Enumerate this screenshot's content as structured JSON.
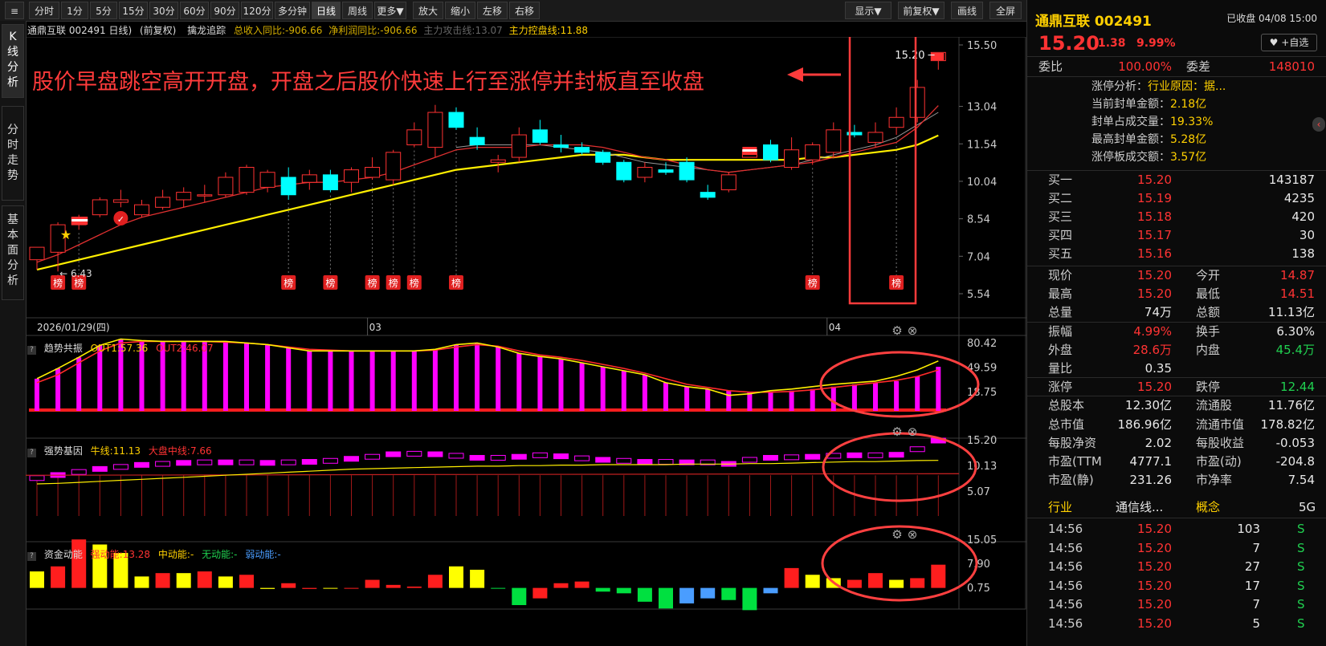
{
  "toolbar": {
    "periods": [
      "分时",
      "1分",
      "5分",
      "15分",
      "30分",
      "60分",
      "90分",
      "120分",
      "多分钟",
      "日线",
      "周线",
      "更多▼",
      "放大",
      "缩小",
      "左移",
      "右移"
    ],
    "active": "日线",
    "right_buttons": [
      "显示▼",
      "前复权▼",
      "画线",
      "全屏"
    ]
  },
  "left_tabs": [
    "K线分析",
    "分时走势",
    "基本面分析"
  ],
  "kline_info": {
    "stock": "通鼎互联 002491 日线)",
    "adjust": "(前复权)",
    "indicator": "擒龙追踪",
    "revenue_yoy": "总收入同比:-906.66",
    "profit_yoy": "净利润同比:-906.66",
    "attack_line": "主力攻击线:13.07",
    "control_line": "主力控盘线:11.88"
  },
  "annotation": {
    "text": "股价早盘跳空高开开盘，开盘之后股价快速上行至涨停并封板直至收盘",
    "color": "#ff3b3b"
  },
  "price_axis": [
    "15.50",
    "13.04",
    "11.54",
    "10.04",
    "8.54",
    "7.04",
    "5.54"
  ],
  "date_axis": [
    "2026/01/29(四)",
    "03",
    "04"
  ],
  "labels": {
    "low_price": "6.43",
    "high_price": "15.20",
    "bang": "榜"
  },
  "trend_panel": {
    "title": "趋势共振",
    "out1": "OUT1:57.36",
    "out2": "OUT2:46.07",
    "axis": [
      "80.42",
      "49.59",
      "18.75"
    ]
  },
  "gene_panel": {
    "title": "强势基因",
    "bull": "牛线:11.13",
    "market": "大盘中线:7.66",
    "axis": [
      "15.20",
      "10.13",
      "5.07"
    ]
  },
  "fund_panel": {
    "title": "资金动能",
    "strong": "强动能:13.28",
    "mid": "中动能:-",
    "none": "无动能:-",
    "weak": "弱动能:-",
    "axis": [
      "15.05",
      "7.90",
      "0.75"
    ]
  },
  "quote": {
    "name": "通鼎互联 002491",
    "status": "已收盘 04/08 15:00",
    "price": "15.20",
    "change": "1.38",
    "pct": "9.99%",
    "self_select": "+自选",
    "wb_label": "委比",
    "wb": "100.00%",
    "wc_label": "委差",
    "wc": "148010",
    "limit_analysis": [
      {
        "label": "涨停分析：",
        "value": "行业原因：据..."
      },
      {
        "label": "当前封单金额：",
        "value": "2.18亿"
      },
      {
        "label": "封单占成交量：",
        "value": "19.33%"
      },
      {
        "label": "最高封单金额：",
        "value": "5.28亿"
      },
      {
        "label": "涨停板成交额：",
        "value": "3.57亿"
      }
    ],
    "bids": [
      {
        "label": "买一",
        "price": "15.20",
        "vol": "143187"
      },
      {
        "label": "买二",
        "price": "15.19",
        "vol": "4235"
      },
      {
        "label": "买三",
        "price": "15.18",
        "vol": "420"
      },
      {
        "label": "买四",
        "price": "15.17",
        "vol": "30"
      },
      {
        "label": "买五",
        "price": "15.16",
        "vol": "138"
      }
    ],
    "stats": [
      {
        "l1": "现价",
        "v1": "15.20",
        "c1": "red",
        "l2": "今开",
        "v2": "14.87",
        "c2": "red"
      },
      {
        "l1": "最高",
        "v1": "15.20",
        "c1": "red",
        "l2": "最低",
        "v2": "14.51",
        "c2": "red"
      },
      {
        "l1": "总量",
        "v1": "74万",
        "c1": "white",
        "l2": "总额",
        "v2": "11.13亿",
        "c2": "white"
      },
      {
        "l1": "振幅",
        "v1": "4.99%",
        "c1": "red",
        "l2": "换手",
        "v2": "6.30%",
        "c2": "white"
      },
      {
        "l1": "外盘",
        "v1": "28.6万",
        "c1": "red",
        "l2": "内盘",
        "v2": "45.4万",
        "c2": "green"
      },
      {
        "l1": "量比",
        "v1": "0.35",
        "c1": "white",
        "l2": "",
        "v2": "",
        "c2": "white"
      },
      {
        "l1": "涨停",
        "v1": "15.20",
        "c1": "red",
        "l2": "跌停",
        "v2": "12.44",
        "c2": "green"
      },
      {
        "l1": "总股本",
        "v1": "12.30亿",
        "c1": "white",
        "l2": "流通股",
        "v2": "11.76亿",
        "c2": "white"
      },
      {
        "l1": "总市值",
        "v1": "186.96亿",
        "c1": "white",
        "l2": "流通市值",
        "v2": "178.82亿",
        "c2": "white"
      },
      {
        "l1": "每股净资",
        "v1": "2.02",
        "c1": "white",
        "l2": "每股收益",
        "v2": "-0.053",
        "c2": "white"
      },
      {
        "l1": "市盈(TTM",
        "v1": "4777.1",
        "c1": "white",
        "l2": "市盈(动)",
        "v2": "-204.8",
        "c2": "white"
      },
      {
        "l1": "市盈(静)",
        "v1": "231.26",
        "c1": "white",
        "l2": "市净率",
        "v2": "7.54",
        "c2": "white"
      }
    ],
    "industry_label": "行业",
    "industry": "通信线...",
    "concept_label": "概念",
    "concept": "5G",
    "trades": [
      {
        "time": "14:56",
        "price": "15.20",
        "vol": "103",
        "side": "S"
      },
      {
        "time": "14:56",
        "price": "15.20",
        "vol": "7",
        "side": "S"
      },
      {
        "time": "14:56",
        "price": "15.20",
        "vol": "27",
        "side": "S"
      },
      {
        "time": "14:56",
        "price": "15.20",
        "vol": "17",
        "side": "S"
      },
      {
        "time": "14:56",
        "price": "15.20",
        "vol": "7",
        "side": "S"
      },
      {
        "time": "14:56",
        "price": "15.20",
        "vol": "5",
        "side": "S"
      }
    ]
  },
  "chart_data": {
    "type": "candlestick",
    "candles": [
      {
        "o": 6.9,
        "h": 7.3,
        "l": 6.5,
        "c": 7.4
      },
      {
        "o": 7.2,
        "h": 8.4,
        "l": 6.43,
        "c": 8.3
      },
      {
        "o": 8.3,
        "h": 8.7,
        "l": 8.1,
        "c": 8.6
      },
      {
        "o": 8.7,
        "h": 9.4,
        "l": 8.6,
        "c": 9.3
      },
      {
        "o": 9.2,
        "h": 9.7,
        "l": 9.0,
        "c": 9.3
      },
      {
        "o": 8.7,
        "h": 9.3,
        "l": 8.6,
        "c": 9.1
      },
      {
        "o": 9.0,
        "h": 9.7,
        "l": 8.9,
        "c": 9.4
      },
      {
        "o": 9.3,
        "h": 9.8,
        "l": 9.0,
        "c": 9.6
      },
      {
        "o": 9.5,
        "h": 9.9,
        "l": 9.2,
        "c": 9.5
      },
      {
        "o": 9.5,
        "h": 10.4,
        "l": 9.4,
        "c": 10.2
      },
      {
        "o": 9.6,
        "h": 10.7,
        "l": 9.5,
        "c": 10.6
      },
      {
        "o": 9.8,
        "h": 10.5,
        "l": 9.6,
        "c": 10.4
      },
      {
        "o": 10.2,
        "h": 10.6,
        "l": 9.3,
        "c": 9.5
      },
      {
        "o": 10.0,
        "h": 10.5,
        "l": 9.7,
        "c": 10.3
      },
      {
        "o": 10.3,
        "h": 10.5,
        "l": 9.6,
        "c": 9.7
      },
      {
        "o": 10.0,
        "h": 10.6,
        "l": 9.6,
        "c": 10.5
      },
      {
        "o": 10.2,
        "h": 11.0,
        "l": 10.1,
        "c": 10.6
      },
      {
        "o": 10.1,
        "h": 11.3,
        "l": 9.9,
        "c": 11.2
      },
      {
        "o": 11.5,
        "h": 12.4,
        "l": 11.4,
        "c": 12.1
      },
      {
        "o": 11.4,
        "h": 13.1,
        "l": 11.0,
        "c": 12.8
      },
      {
        "o": 12.8,
        "h": 13.0,
        "l": 12.1,
        "c": 12.2
      },
      {
        "o": 11.8,
        "h": 12.2,
        "l": 11.3,
        "c": 11.5
      },
      {
        "o": 10.8,
        "h": 11.1,
        "l": 10.4,
        "c": 10.9
      },
      {
        "o": 11.0,
        "h": 12.2,
        "l": 10.8,
        "c": 11.9
      },
      {
        "o": 12.1,
        "h": 12.5,
        "l": 11.5,
        "c": 11.6
      },
      {
        "o": 11.5,
        "h": 11.9,
        "l": 11.2,
        "c": 11.4
      },
      {
        "o": 11.4,
        "h": 11.6,
        "l": 11.1,
        "c": 11.2
      },
      {
        "o": 11.2,
        "h": 11.3,
        "l": 10.7,
        "c": 10.8
      },
      {
        "o": 10.8,
        "h": 10.9,
        "l": 10.0,
        "c": 10.1
      },
      {
        "o": 10.2,
        "h": 10.8,
        "l": 10.0,
        "c": 10.6
      },
      {
        "o": 10.5,
        "h": 10.8,
        "l": 10.3,
        "c": 10.4
      },
      {
        "o": 10.8,
        "h": 11.0,
        "l": 10.0,
        "c": 10.1
      },
      {
        "o": 9.6,
        "h": 9.9,
        "l": 9.3,
        "c": 9.4
      },
      {
        "o": 9.7,
        "h": 10.4,
        "l": 9.6,
        "c": 10.3
      },
      {
        "o": 11.0,
        "h": 11.3,
        "l": 11.0,
        "c": 11.3
      },
      {
        "o": 11.5,
        "h": 11.7,
        "l": 10.8,
        "c": 10.9
      },
      {
        "o": 10.6,
        "h": 11.8,
        "l": 10.5,
        "c": 11.3
      },
      {
        "o": 10.9,
        "h": 11.6,
        "l": 10.7,
        "c": 11.5
      },
      {
        "o": 11.2,
        "h": 12.4,
        "l": 11.0,
        "c": 12.1
      },
      {
        "o": 12.0,
        "h": 12.3,
        "l": 11.8,
        "c": 11.9
      },
      {
        "o": 11.6,
        "h": 12.4,
        "l": 11.4,
        "c": 12.0
      },
      {
        "o": 12.2,
        "h": 13.0,
        "l": 11.9,
        "c": 12.6
      },
      {
        "o": 12.6,
        "h": 14.1,
        "l": 12.4,
        "c": 13.8
      },
      {
        "o": 14.87,
        "h": 15.2,
        "l": 14.51,
        "c": 15.2
      }
    ],
    "ma_red": [
      6.8,
      7.1,
      7.5,
      7.9,
      8.3,
      8.6,
      8.8,
      9.0,
      9.2,
      9.4,
      9.6,
      9.8,
      9.9,
      10.0,
      10.0,
      10.1,
      10.2,
      10.4,
      10.7,
      11.0,
      11.3,
      11.4,
      11.4,
      11.4,
      11.5,
      11.5,
      11.5,
      11.4,
      11.2,
      11.0,
      10.9,
      10.7,
      10.5,
      10.4,
      10.5,
      10.6,
      10.7,
      10.8,
      11.0,
      11.2,
      11.4,
      11.6,
      12.2,
      13.07
    ],
    "ma_gray": [
      null,
      null,
      null,
      null,
      null,
      null,
      null,
      null,
      null,
      null,
      null,
      null,
      null,
      null,
      null,
      null,
      null,
      null,
      null,
      null,
      11.4,
      11.5,
      11.5,
      11.5,
      11.5,
      11.4,
      11.3,
      11.2,
      11.0,
      10.8,
      10.7,
      10.6,
      10.5,
      10.4,
      10.5,
      10.6,
      10.7,
      10.9,
      11.1,
      11.3,
      11.5,
      11.8,
      12.3,
      12.8
    ],
    "ma_yellow": [
      6.5,
      6.7,
      6.9,
      7.1,
      7.3,
      7.5,
      7.7,
      7.9,
      8.1,
      8.3,
      8.5,
      8.7,
      8.9,
      9.1,
      9.3,
      9.5,
      9.7,
      9.9,
      10.1,
      10.3,
      10.5,
      10.6,
      10.7,
      10.8,
      10.9,
      11.0,
      11.1,
      11.1,
      11.1,
      11.0,
      10.9,
      10.9,
      10.9,
      10.9,
      10.9,
      10.9,
      10.9,
      11.0,
      11.0,
      11.1,
      11.2,
      11.3,
      11.5,
      11.88
    ],
    "bang_index": [
      1,
      2,
      12,
      14,
      16,
      17,
      18,
      20,
      37,
      41
    ],
    "trend_bars": [
      35,
      48,
      62,
      77,
      85,
      83,
      82,
      82,
      82,
      82,
      80,
      78,
      74,
      70,
      70,
      70,
      70,
      70,
      70,
      72,
      78,
      80,
      75,
      67,
      63,
      60,
      55,
      50,
      45,
      40,
      30,
      25,
      22,
      20,
      18,
      18,
      20,
      22,
      25,
      28,
      30,
      32,
      38,
      50
    ],
    "trend_out1": [
      35,
      48,
      62,
      77,
      85,
      83,
      82,
      82,
      82,
      82,
      80,
      78,
      74,
      70,
      70,
      70,
      70,
      70,
      70,
      72,
      78,
      80,
      75,
      67,
      63,
      60,
      55,
      50,
      45,
      40,
      30,
      25,
      22,
      14,
      16,
      20,
      22,
      25,
      28,
      30,
      32,
      38,
      46,
      57.36
    ],
    "trend_out2": [
      30,
      40,
      55,
      70,
      80,
      82,
      82,
      82,
      82,
      81,
      80,
      78,
      75,
      72,
      71,
      70,
      70,
      70,
      70,
      71,
      75,
      78,
      76,
      70,
      65,
      62,
      58,
      53,
      48,
      42,
      35,
      28,
      24,
      20,
      18,
      18,
      19,
      21,
      24,
      27,
      30,
      33,
      38,
      46.07
    ],
    "gene_box": [
      7.8,
      8.4,
      9.0,
      9.6,
      10.0,
      10.4,
      10.6,
      10.8,
      10.9,
      10.9,
      10.9,
      10.8,
      10.9,
      11.0,
      11.2,
      11.6,
      12.0,
      12.5,
      12.6,
      12.5,
      12.2,
      11.8,
      11.8,
      12.0,
      12.3,
      12.1,
      11.7,
      11.4,
      11.2,
      11.0,
      11.0,
      10.9,
      10.9,
      10.6,
      11.4,
      11.8,
      11.9,
      12.0,
      12.2,
      12.3,
      12.3,
      12.4,
      13.5,
      15.2
    ],
    "gene_bull": [
      6.5,
      6.6,
      6.8,
      7.0,
      7.2,
      7.4,
      7.6,
      7.8,
      8.0,
      8.2,
      8.4,
      8.6,
      8.8,
      9.0,
      9.2,
      9.4,
      9.5,
      9.6,
      9.7,
      9.8,
      9.9,
      10.0,
      10.0,
      10.1,
      10.1,
      10.2,
      10.2,
      10.3,
      10.3,
      10.3,
      10.3,
      10.4,
      10.4,
      10.4,
      10.5,
      10.5,
      10.6,
      10.7,
      10.8,
      10.9,
      10.9,
      11.0,
      11.1,
      11.13
    ],
    "fund_bars": [
      5.5,
      7.0,
      15.0,
      13.5,
      11.0,
      4.0,
      5.0,
      5.0,
      5.5,
      4.0,
      4.5,
      0.3,
      2.0,
      0.3,
      0.5,
      0.5,
      3.0,
      1.5,
      1.0,
      4.5,
      7.0,
      6.0,
      0.4,
      -4.5,
      -2.5,
      2.0,
      2.5,
      -0.5,
      -1.0,
      -3.5,
      -5.5,
      -4.0,
      -2.5,
      -3.0,
      -6.0,
      -1.0,
      6.5,
      4.5,
      3.5,
      3.0,
      5.0,
      3.0,
      3.5,
      7.5,
      13.28
    ],
    "fund_colors": [
      "y",
      "r",
      "r",
      "y",
      "y",
      "y",
      "r",
      "y",
      "r",
      "y",
      "r",
      "y",
      "r",
      "r",
      "y",
      "r",
      "r",
      "r",
      "r",
      "r",
      "y",
      "y",
      "g",
      "g",
      "r",
      "r",
      "r",
      "g",
      "g",
      "g",
      "g",
      "b",
      "b",
      "g",
      "g",
      "b",
      "r",
      "y",
      "y",
      "r",
      "r",
      "y",
      "r",
      "r"
    ]
  }
}
